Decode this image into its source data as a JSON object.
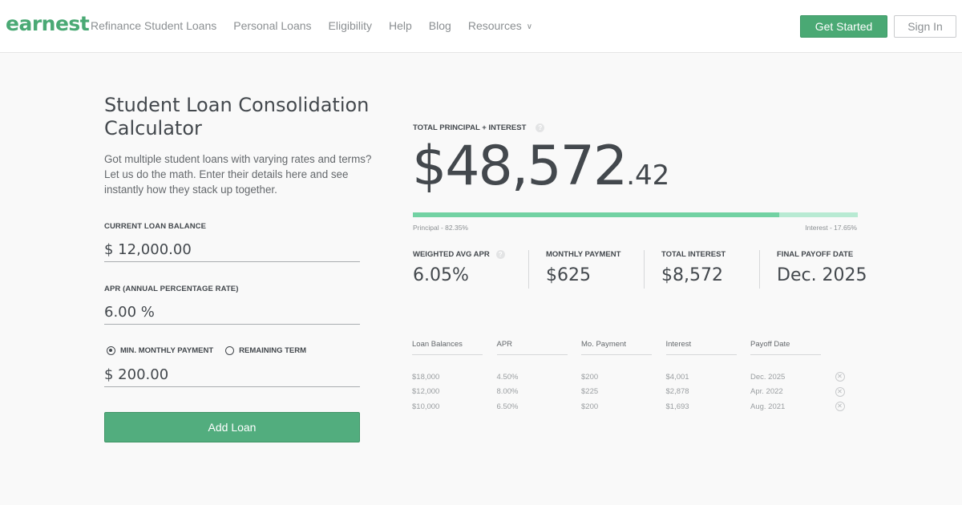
{
  "header": {
    "logo": "earnest",
    "nav": [
      {
        "label": "Refinance Student Loans"
      },
      {
        "label": "Personal Loans"
      },
      {
        "label": "Eligibility"
      },
      {
        "label": "Help"
      },
      {
        "label": "Blog"
      },
      {
        "label": "Resources",
        "has_dropdown": true
      }
    ],
    "get_started_label": "Get Started",
    "sign_in_label": "Sign In"
  },
  "calculator": {
    "title": "Student Loan Consolidation Calculator",
    "description": "Got multiple student loans with varying rates and terms? Let us do the math. Enter their details here and see instantly how they stack up together.",
    "balance_label": "CURRENT LOAN BALANCE",
    "balance_value": "$ 12,000.00",
    "apr_label": "APR (ANNUAL PERCENTAGE RATE)",
    "apr_value": "6.00 %",
    "radio_options": [
      {
        "label": "MIN. MONTHLY PAYMENT",
        "checked": true
      },
      {
        "label": "REMAINING TERM",
        "checked": false
      }
    ],
    "payment_value": "$ 200.00",
    "add_loan_label": "Add Loan"
  },
  "results": {
    "total_label": "TOTAL PRINCIPAL + INTEREST",
    "total_whole": "$48,572",
    "total_cents": ".42",
    "principal_percent": 82.35,
    "principal_label": "Principal - 82.35%",
    "interest_label": "Interest - 17.65%",
    "stats": [
      {
        "label": "WEIGHTED AVG APR",
        "value": "6.05%",
        "help": true
      },
      {
        "label": "MONTHLY PAYMENT",
        "value": "$625",
        "help": false
      },
      {
        "label": "TOTAL INTEREST",
        "value": "$8,572",
        "help": false
      },
      {
        "label": "FINAL PAYOFF DATE",
        "value": "Dec. 2025",
        "help": false
      }
    ],
    "table": {
      "headers": [
        "Loan Balances",
        "APR",
        "Mo. Payment",
        "Interest",
        "Payoff Date"
      ],
      "rows": [
        [
          "$18,000",
          "4.50%",
          "$200",
          "$4,001",
          "Dec. 2025"
        ],
        [
          "$12,000",
          "8.00%",
          "$225",
          "$2,878",
          "Apr. 2022"
        ],
        [
          "$10,000",
          "6.50%",
          "$200",
          "$1,693",
          "Aug. 2021"
        ]
      ]
    }
  },
  "colors": {
    "brand_green": "#4aa974",
    "principal_bar": "#72d2a3",
    "interest_bar": "#b8ead3",
    "text_dark": "#43484d"
  }
}
